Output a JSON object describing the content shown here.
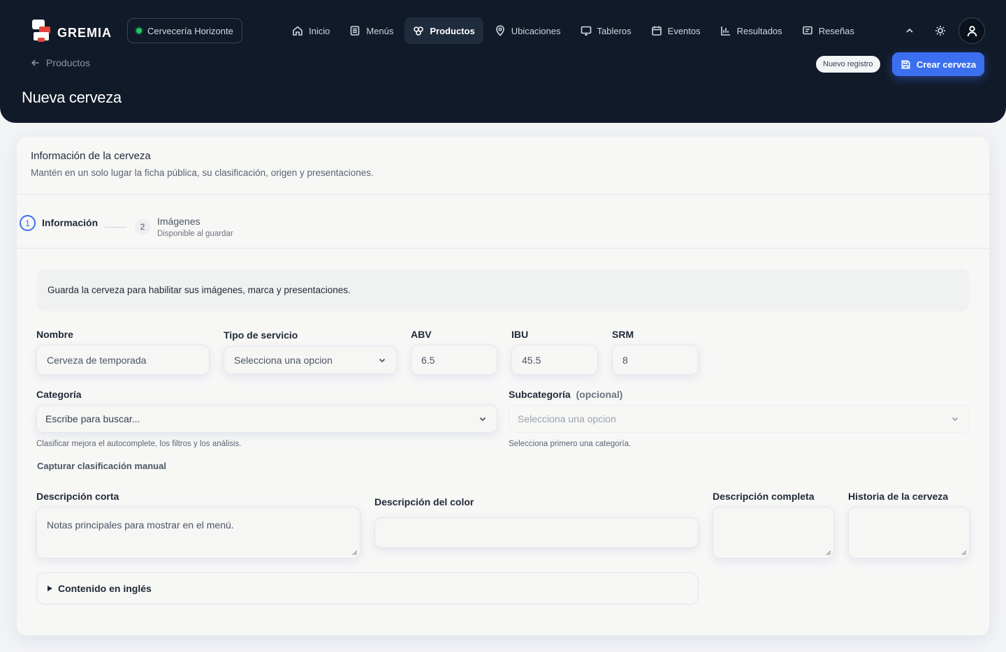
{
  "brand": {
    "name": "GREMIA"
  },
  "brewery": {
    "name": "Cervecería Horizonte",
    "status_color": "#22c55e"
  },
  "nav": [
    {
      "label": "Inicio",
      "icon": "home-icon"
    },
    {
      "label": "Menús",
      "icon": "menu-doc-icon"
    },
    {
      "label": "Productos",
      "icon": "bottles-icon",
      "active": true
    },
    {
      "label": "Ubicaciones",
      "icon": "map-pin-icon"
    },
    {
      "label": "Tableros",
      "icon": "monitor-icon"
    },
    {
      "label": "Eventos",
      "icon": "calendar-icon"
    },
    {
      "label": "Resultados",
      "icon": "bar-chart-icon"
    },
    {
      "label": "Reseñas",
      "icon": "message-icon"
    }
  ],
  "breadcrumb": {
    "back_label": "Productos"
  },
  "page": {
    "title": "Nueva cerveza",
    "badge": "Nuevo registro",
    "create_label": "Crear cerveza",
    "accent": "#3b6ff0"
  },
  "card": {
    "title": "Información de la cerveza",
    "subtitle": "Mantén en un solo lugar la ficha pública, su clasificación, origen y presentaciones."
  },
  "steps": [
    {
      "number": "1",
      "label": "Información"
    },
    {
      "number": "2",
      "label": "Imágenes",
      "sub": "Disponible al guardar"
    }
  ],
  "notice": "Guarda la cerveza para habilitar sus imágenes, marca y presentaciones.",
  "form": {
    "nombre": {
      "label": "Nombre",
      "placeholder": "Cerveza de temporada"
    },
    "tipo": {
      "label": "Tipo de servicio",
      "value": "Selecciona una opcion"
    },
    "abv": {
      "label": "ABV",
      "value": "6.5"
    },
    "ibu": {
      "label": "IBU",
      "value": "45.5"
    },
    "srm": {
      "label": "SRM",
      "value": "8"
    },
    "categoria": {
      "label": "Categoría",
      "placeholder": "Escribe para buscar...",
      "hint": "Clasificar mejora el autocomplete, los filtros y los análisis."
    },
    "subcategoria": {
      "label": "Subcategoría",
      "optional": "(opcional)",
      "value": "Selecciona una opcion",
      "hint": "Selecciona primero una categoría."
    },
    "manual_link": "Capturar clasificación manual",
    "desc_corta": {
      "label": "Descripción corta",
      "placeholder": "Notas principales para mostrar en el menú."
    },
    "desc_color": {
      "label": "Descripción del color",
      "value": ""
    },
    "desc_completa": {
      "label": "Descripción completa",
      "value": ""
    },
    "historia": {
      "label": "Historia de la cerveza",
      "value": ""
    },
    "english_section": "Contenido en inglés"
  }
}
